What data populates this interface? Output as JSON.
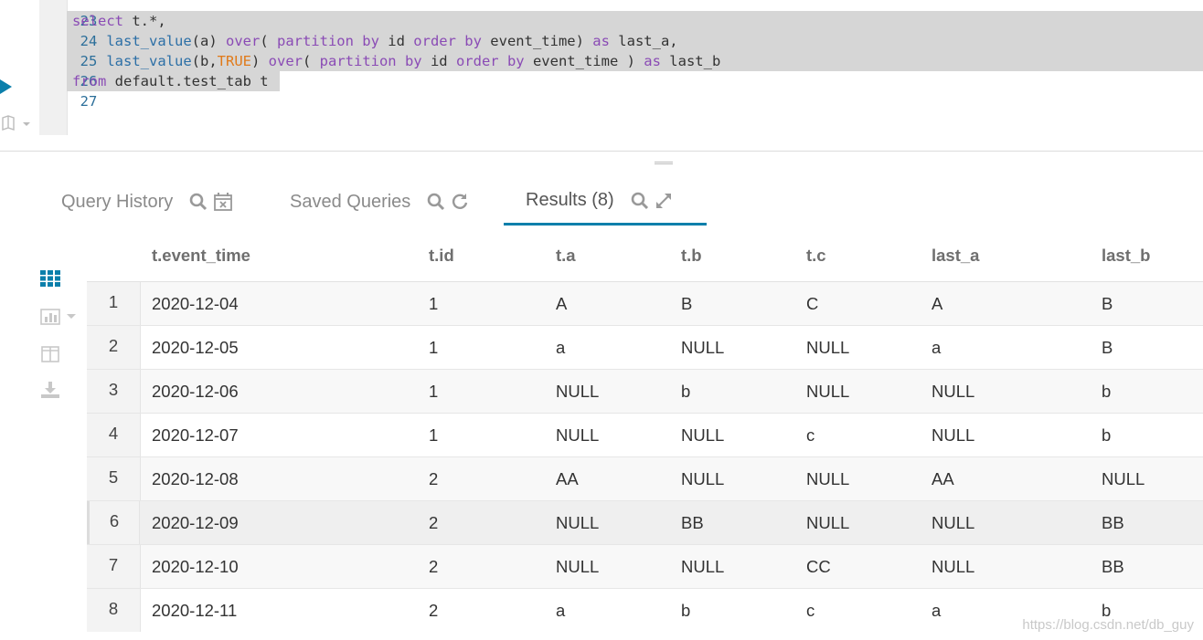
{
  "editor": {
    "lines": [
      {
        "num": "23"
      },
      {
        "num": "24"
      },
      {
        "num": "25"
      },
      {
        "num": "26"
      },
      {
        "num": "27"
      }
    ],
    "code": {
      "l24_a": "select",
      "l24_b": " t.*,",
      "l25_fn": "last_value",
      "l25_b": "(a) ",
      "l25_kw1": "over",
      "l25_c": "( ",
      "l25_kw2": "partition by",
      "l25_d": " id ",
      "l25_kw3": "order by",
      "l25_e": " event_time) ",
      "l25_kw4": "as",
      "l25_f": " last_a,",
      "l26_fn": "last_value",
      "l26_b": "(b,",
      "l26_lit": "TRUE",
      "l26_c": ") ",
      "l26_kw1": "over",
      "l26_d": "( ",
      "l26_kw2": "partition by",
      "l26_e": " id ",
      "l26_kw3": "order by",
      "l26_f": " event_time ) ",
      "l26_kw4": "as",
      "l26_g": " last_b",
      "l27_kw": "from",
      "l27_b": " default.test_tab t"
    }
  },
  "tabs": {
    "query_history": "Query History",
    "saved_queries": "Saved Queries",
    "results": "Results (8)"
  },
  "results": {
    "columns": [
      "t.event_time",
      "t.id",
      "t.a",
      "t.b",
      "t.c",
      "last_a",
      "last_b"
    ],
    "rows": [
      [
        "1",
        "2020-12-04",
        "1",
        "A",
        "B",
        "C",
        "A",
        "B"
      ],
      [
        "2",
        "2020-12-05",
        "1",
        "a",
        "NULL",
        "NULL",
        "a",
        "B"
      ],
      [
        "3",
        "2020-12-06",
        "1",
        "NULL",
        "b",
        "NULL",
        "NULL",
        "b"
      ],
      [
        "4",
        "2020-12-07",
        "1",
        "NULL",
        "NULL",
        "c",
        "NULL",
        "b"
      ],
      [
        "5",
        "2020-12-08",
        "2",
        "AA",
        "NULL",
        "NULL",
        "AA",
        "NULL"
      ],
      [
        "6",
        "2020-12-09",
        "2",
        "NULL",
        "BB",
        "NULL",
        "NULL",
        "BB"
      ],
      [
        "7",
        "2020-12-10",
        "2",
        "NULL",
        "NULL",
        "CC",
        "NULL",
        "BB"
      ],
      [
        "8",
        "2020-12-11",
        "2",
        "a",
        "b",
        "c",
        "a",
        "b"
      ]
    ]
  },
  "watermark": "https://blog.csdn.net/db_guy",
  "colors": {
    "accent": "#0b7fab",
    "keyword": "#8a4bb5",
    "function": "#2c6fa6",
    "literal": "#e07a1a"
  },
  "icons": [
    "play-icon",
    "book-icon",
    "search-icon",
    "calendar-icon",
    "refresh-icon",
    "expand-icon",
    "grid-icon",
    "bar-chart-icon",
    "columns-icon",
    "download-icon"
  ]
}
